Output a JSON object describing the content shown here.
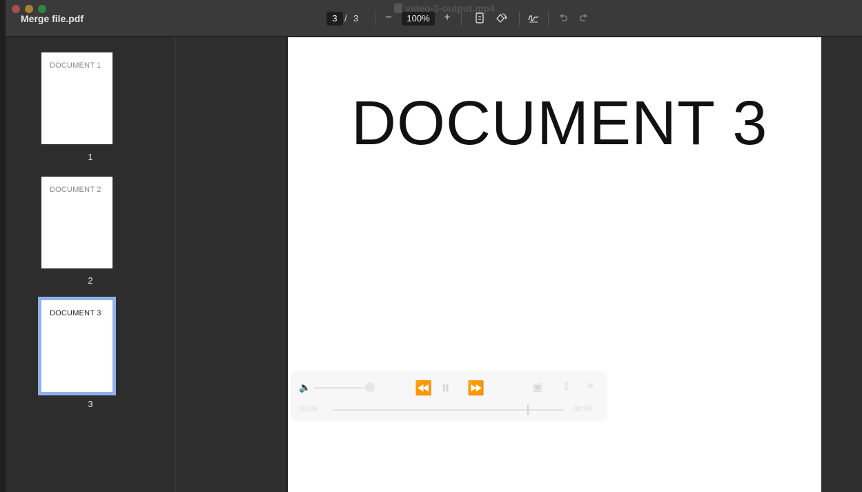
{
  "window": {
    "title": "Merge file.pdf",
    "video_title": "video-3-output.mp4"
  },
  "toolbar": {
    "current_page": "3",
    "separator": "/",
    "total_pages": "3",
    "zoom_out": "−",
    "zoom": "100%",
    "zoom_in": "+"
  },
  "sidebar": {
    "thumbnails": [
      {
        "label": "DOCUMENT 1",
        "number": "1"
      },
      {
        "label": "DOCUMENT 2",
        "number": "2"
      },
      {
        "label": "DOCUMENT 3",
        "number": "3"
      }
    ],
    "selected_index": 2
  },
  "page": {
    "heading": "DOCUMENT 3"
  },
  "video_overlay": {
    "elapsed": "00:06",
    "remaining": "00:07"
  }
}
